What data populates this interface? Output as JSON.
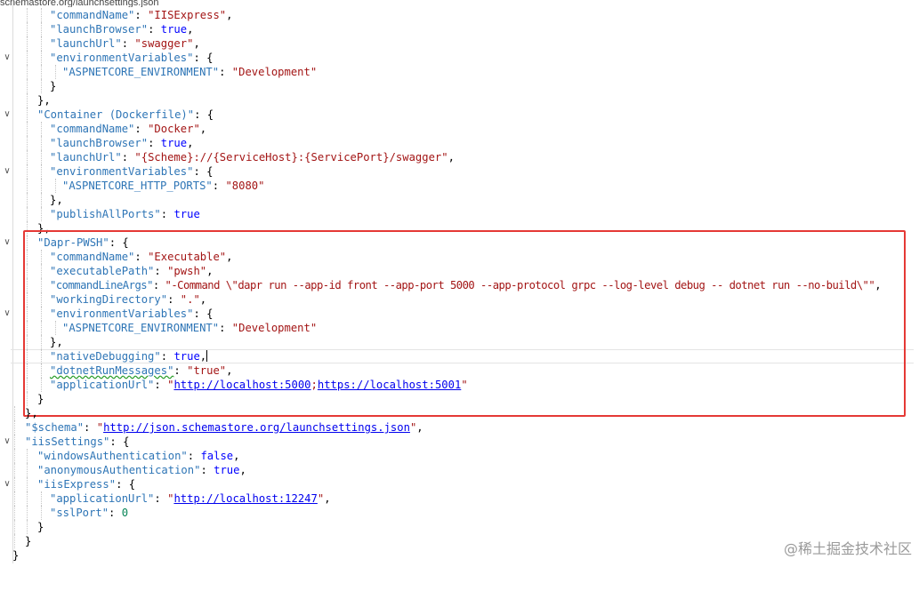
{
  "header": {
    "path_fragment": "schemastore.org/launchsettings.json"
  },
  "watermark": "@稀土掘金技术社区",
  "code": {
    "l1": {
      "key": "\"commandName\"",
      "value": "\"IISExpress\""
    },
    "l2": {
      "key": "\"launchBrowser\"",
      "value": "true"
    },
    "l3": {
      "key": "\"launchUrl\"",
      "value": "\"swagger\""
    },
    "l4": {
      "key": "\"environmentVariables\""
    },
    "l5": {
      "key": "\"ASPNETCORE_ENVIRONMENT\"",
      "value": "\"Development\""
    },
    "l8": {
      "key": "\"Container (Dockerfile)\""
    },
    "l9": {
      "key": "\"commandName\"",
      "value": "\"Docker\""
    },
    "l10": {
      "key": "\"launchBrowser\"",
      "value": "true"
    },
    "l11": {
      "key": "\"launchUrl\"",
      "value": "\"{Scheme}://{ServiceHost}:{ServicePort}/swagger\""
    },
    "l12": {
      "key": "\"environmentVariables\""
    },
    "l13": {
      "key": "\"ASPNETCORE_HTTP_PORTS\"",
      "value": "\"8080\""
    },
    "l15": {
      "key": "\"publishAllPorts\"",
      "value": "true"
    },
    "l17": {
      "key": "\"Dapr-PWSH\""
    },
    "l18": {
      "key": "\"commandName\"",
      "value": "\"Executable\""
    },
    "l19": {
      "key": "\"executablePath\"",
      "value": "\"pwsh\""
    },
    "l20": {
      "key": "\"commandLineArgs\"",
      "value": "\"-Command \\\"dapr run --app-id front --app-port 5000 --app-protocol grpc --log-level debug -- dotnet run --no-build\\\"\""
    },
    "l21": {
      "key": "\"workingDirectory\"",
      "value": "\".\""
    },
    "l22": {
      "key": "\"environmentVariables\""
    },
    "l23": {
      "key": "\"ASPNETCORE_ENVIRONMENT\"",
      "value": "\"Development\""
    },
    "l25": {
      "key": "\"nativeDebugging\"",
      "value": "true"
    },
    "l26": {
      "key": "\"dotnetRunMessages\"",
      "value": "\"true\""
    },
    "l27": {
      "key": "\"applicationUrl\"",
      "url1": "http://localhost:5000",
      "url2": "https://localhost:5001"
    },
    "l30": {
      "key": "\"$schema\"",
      "url": "http://json.schemastore.org/launchsettings.json"
    },
    "l31": {
      "key": "\"iisSettings\""
    },
    "l32": {
      "key": "\"windowsAuthentication\"",
      "value": "false"
    },
    "l33": {
      "key": "\"anonymousAuthentication\"",
      "value": "true"
    },
    "l34": {
      "key": "\"iisExpress\""
    },
    "l35": {
      "key": "\"applicationUrl\"",
      "url": "http://localhost:12247"
    },
    "l36": {
      "key": "\"sslPort\"",
      "value": "0"
    }
  },
  "colors": {
    "key": "#2e75b6",
    "string": "#a31515",
    "keyword": "#0000ff",
    "link": "#0000ee",
    "highlight_border": "#e53935"
  }
}
